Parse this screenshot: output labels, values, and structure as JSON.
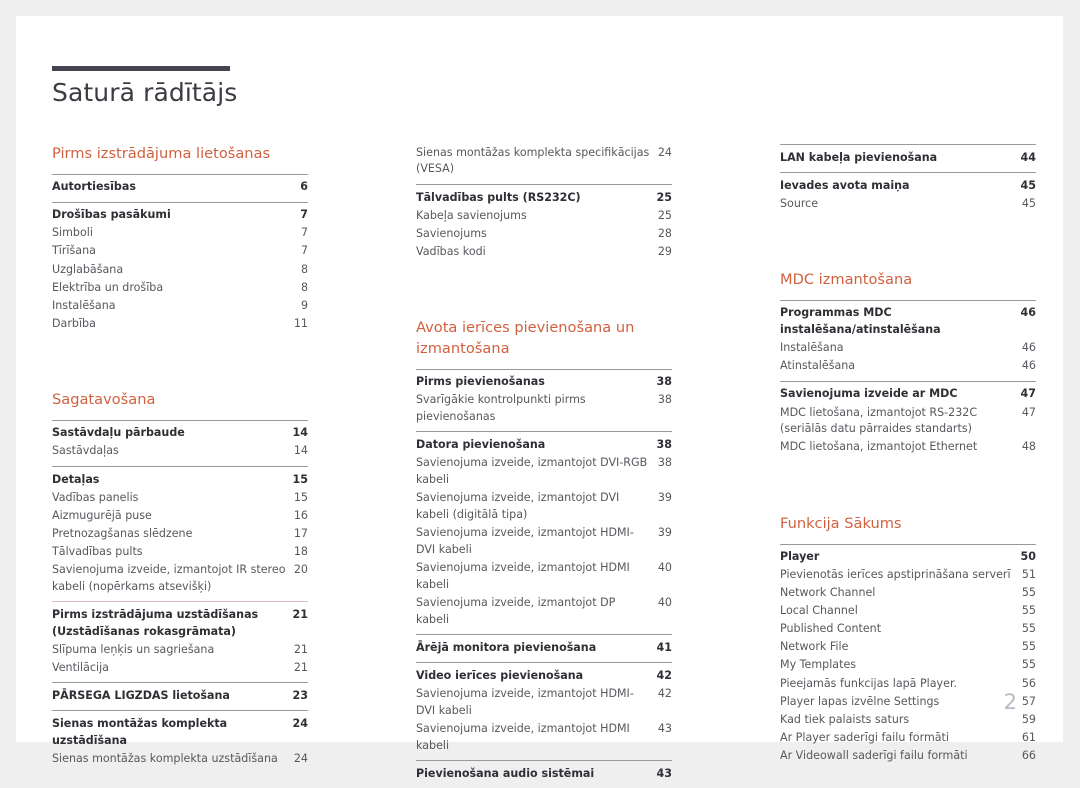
{
  "document": {
    "title": "Saturā rādītājs",
    "page_number": "2",
    "accent_color": "#d0613f",
    "rule_color": "#45434f",
    "pink_rule_color": "#e3b9c6"
  },
  "columns": [
    {
      "name": "column-1",
      "blocks": [
        {
          "type": "section",
          "title": "Pirms izstrādājuma lietošanas",
          "spaced_top": false,
          "groups": [
            {
              "rule": "solid",
              "entries": [
                {
                  "label": "Autortiesības",
                  "page": "6",
                  "bold": true
                }
              ]
            },
            {
              "rule": "solid",
              "entries": [
                {
                  "label": "Drošības pasākumi",
                  "page": "7",
                  "bold": true
                },
                {
                  "label": "Simboli",
                  "page": "7",
                  "bold": false
                },
                {
                  "label": "Tīrīšana",
                  "page": "7",
                  "bold": false
                },
                {
                  "label": "Uzglabāšana",
                  "page": "8",
                  "bold": false
                },
                {
                  "label": "Elektrība un drošība",
                  "page": "8",
                  "bold": false
                },
                {
                  "label": "Instalēšana",
                  "page": "9",
                  "bold": false
                },
                {
                  "label": "Darbība",
                  "page": "11",
                  "bold": false
                }
              ]
            }
          ]
        },
        {
          "type": "section",
          "title": "Sagatavošana",
          "spaced_top": true,
          "groups": [
            {
              "rule": "solid",
              "entries": [
                {
                  "label": "Sastāvdaļu pārbaude",
                  "page": "14",
                  "bold": true
                },
                {
                  "label": "Sastāvdaļas",
                  "page": "14",
                  "bold": false
                }
              ]
            },
            {
              "rule": "solid",
              "entries": [
                {
                  "label": "Detaļas",
                  "page": "15",
                  "bold": true
                },
                {
                  "label": "Vadības panelis",
                  "page": "15",
                  "bold": false
                },
                {
                  "label": "Aizmugurējā puse",
                  "page": "16",
                  "bold": false
                },
                {
                  "label": "Pretnozagšanas slēdzene",
                  "page": "17",
                  "bold": false
                },
                {
                  "label": "Tālvadības pults",
                  "page": "18",
                  "bold": false
                },
                {
                  "label": "Savienojuma izveide, izmantojot IR stereo kabeli (nopērkams atsevišķi)",
                  "page": "20",
                  "bold": false
                }
              ]
            },
            {
              "rule": "pink",
              "entries": [
                {
                  "label": "Pirms izstrādājuma uzstādīšanas (Uzstādīšanas rokasgrāmata)",
                  "page": "21",
                  "bold": true
                },
                {
                  "label": "Slīpuma leņķis un sagriešana",
                  "page": "21",
                  "bold": false
                },
                {
                  "label": "Ventilācija",
                  "page": "21",
                  "bold": false
                }
              ]
            },
            {
              "rule": "solid",
              "entries": [
                {
                  "label": "PĀRSEGA LIGZDAS lietošana",
                  "page": "23",
                  "bold": true
                }
              ]
            },
            {
              "rule": "solid",
              "entries": [
                {
                  "label": "Sienas montāžas komplekta uzstādīšana",
                  "page": "24",
                  "bold": true
                },
                {
                  "label": "Sienas montāžas komplekta uzstādīšana",
                  "page": "24",
                  "bold": false
                }
              ]
            }
          ]
        }
      ]
    },
    {
      "name": "column-2",
      "blocks": [
        {
          "type": "section",
          "title": "",
          "spaced_top": false,
          "groups": [
            {
              "rule": "none",
              "entries": [
                {
                  "label": "Sienas montāžas komplekta specifikācijas (VESA)",
                  "page": "24",
                  "bold": false
                }
              ]
            },
            {
              "rule": "solid",
              "entries": [
                {
                  "label": "Tālvadības pults (RS232C)",
                  "page": "25",
                  "bold": true
                },
                {
                  "label": "Kabeļa savienojums",
                  "page": "25",
                  "bold": false
                },
                {
                  "label": "Savienojums",
                  "page": "28",
                  "bold": false
                },
                {
                  "label": "Vadības kodi",
                  "page": "29",
                  "bold": false
                }
              ]
            }
          ]
        },
        {
          "type": "section",
          "title": "Avota ierīces pievienošana un izmantošana",
          "spaced_top": true,
          "groups": [
            {
              "rule": "solid",
              "entries": [
                {
                  "label": "Pirms pievienošanas",
                  "page": "38",
                  "bold": true
                },
                {
                  "label": "Svarīgākie kontrolpunkti pirms pievienošanas",
                  "page": "38",
                  "bold": false
                }
              ]
            },
            {
              "rule": "solid",
              "entries": [
                {
                  "label": "Datora pievienošana",
                  "page": "38",
                  "bold": true
                },
                {
                  "label": "Savienojuma izveide, izmantojot DVI-RGB kabeli",
                  "page": "38",
                  "bold": false
                },
                {
                  "label": "Savienojuma izveide, izmantojot DVI kabeli (digitālā tipa)",
                  "page": "39",
                  "bold": false
                },
                {
                  "label": "Savienojuma izveide, izmantojot HDMI-DVI kabeli",
                  "page": "39",
                  "bold": false
                },
                {
                  "label": "Savienojuma izveide, izmantojot HDMI kabeli",
                  "page": "40",
                  "bold": false
                },
                {
                  "label": "Savienojuma izveide, izmantojot DP kabeli",
                  "page": "40",
                  "bold": false
                }
              ]
            },
            {
              "rule": "solid",
              "entries": [
                {
                  "label": "Ārējā monitora pievienošana",
                  "page": "41",
                  "bold": true
                }
              ]
            },
            {
              "rule": "solid",
              "entries": [
                {
                  "label": "Video ierīces pievienošana",
                  "page": "42",
                  "bold": true
                },
                {
                  "label": "Savienojuma izveide, izmantojot HDMI-DVI kabeli",
                  "page": "42",
                  "bold": false
                },
                {
                  "label": "Savienojuma izveide, izmantojot HDMI kabeli",
                  "page": "43",
                  "bold": false
                }
              ]
            },
            {
              "rule": "solid",
              "entries": [
                {
                  "label": "Pievienošana audio sistēmai",
                  "page": "43",
                  "bold": true
                }
              ]
            }
          ]
        }
      ]
    },
    {
      "name": "column-3",
      "blocks": [
        {
          "type": "section",
          "title": "",
          "spaced_top": false,
          "groups": [
            {
              "rule": "solid",
              "entries": [
                {
                  "label": "LAN kabeļa pievienošana",
                  "page": "44",
                  "bold": true
                }
              ]
            },
            {
              "rule": "solid",
              "entries": [
                {
                  "label": "Ievades avota maiņa",
                  "page": "45",
                  "bold": true
                },
                {
                  "label": "Source",
                  "page": "45",
                  "bold": false
                }
              ]
            }
          ]
        },
        {
          "type": "section",
          "title": "MDC izmantošana",
          "spaced_top": true,
          "groups": [
            {
              "rule": "solid",
              "entries": [
                {
                  "label": "Programmas MDC instalēšana/atinstalēšana",
                  "page": "46",
                  "bold": true
                },
                {
                  "label": "Instalēšana",
                  "page": "46",
                  "bold": false
                },
                {
                  "label": "Atinstalēšana",
                  "page": "46",
                  "bold": false
                }
              ]
            },
            {
              "rule": "solid",
              "entries": [
                {
                  "label": "Savienojuma izveide ar MDC",
                  "page": "47",
                  "bold": true
                },
                {
                  "label": "MDC lietošana, izmantojot RS-232C (seriālās datu pārraides standarts)",
                  "page": "47",
                  "bold": false
                },
                {
                  "label": "MDC lietošana, izmantojot Ethernet",
                  "page": "48",
                  "bold": false
                }
              ]
            }
          ]
        },
        {
          "type": "section",
          "title": "Funkcija Sākums",
          "spaced_top": true,
          "groups": [
            {
              "rule": "solid",
              "entries": [
                {
                  "label": "Player",
                  "page": "50",
                  "bold": true
                },
                {
                  "label": "Pievienotās ierīces apstiprināšana serverī",
                  "page": "51",
                  "bold": false
                },
                {
                  "label": "Network Channel",
                  "page": "55",
                  "bold": false
                },
                {
                  "label": "Local Channel",
                  "page": "55",
                  "bold": false
                },
                {
                  "label": "Published Content",
                  "page": "55",
                  "bold": false
                },
                {
                  "label": "Network File",
                  "page": "55",
                  "bold": false
                },
                {
                  "label": "My Templates",
                  "page": "55",
                  "bold": false
                },
                {
                  "label": "Pieejamās funkcijas lapā Player.",
                  "page": "56",
                  "bold": false
                },
                {
                  "label": "Player lapas izvēlne Settings",
                  "page": "57",
                  "bold": false
                },
                {
                  "label": "Kad tiek palaists saturs",
                  "page": "59",
                  "bold": false
                },
                {
                  "label": "Ar Player saderīgi failu formāti",
                  "page": "61",
                  "bold": false
                },
                {
                  "label": "Ar Videowall saderīgi failu formāti",
                  "page": "66",
                  "bold": false
                }
              ]
            }
          ]
        }
      ]
    }
  ]
}
